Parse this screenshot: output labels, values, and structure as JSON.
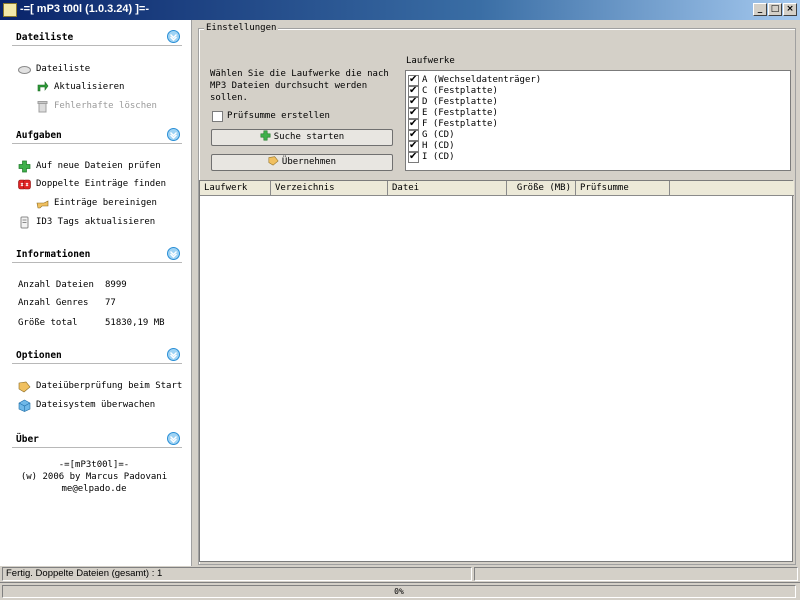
{
  "window": {
    "title": "-=[ mP3 t00l (1.0.3.24) ]=-",
    "minimize": "_",
    "maximize": "□",
    "close": "×"
  },
  "sidebar": {
    "dateiliste": {
      "title": "Dateiliste",
      "items": [
        {
          "label": "Dateiliste",
          "icon": "disk-icon"
        },
        {
          "label": "Aktualisieren",
          "icon": "refresh-icon"
        },
        {
          "label": "Fehlerhafte löschen",
          "icon": "trash-icon",
          "disabled": true
        }
      ]
    },
    "aufgaben": {
      "title": "Aufgaben",
      "items": [
        {
          "label": "Auf neue Dateien prüfen",
          "icon": "plus-icon"
        },
        {
          "label": "Doppelte Einträge finden",
          "icon": "duplicate-icon"
        },
        {
          "label": "Einträge bereinigen",
          "icon": "hand-icon"
        },
        {
          "label": "ID3 Tags aktualisieren",
          "icon": "tag-icon"
        }
      ]
    },
    "informationen": {
      "title": "Informationen",
      "rows": [
        {
          "label": "Anzahl Dateien",
          "value": "8999"
        },
        {
          "label": "Anzahl Genres",
          "value": "77"
        },
        {
          "label": "Größe total",
          "value": "51830,19 MB"
        }
      ]
    },
    "optionen": {
      "title": "Optionen",
      "items": [
        {
          "label": "Dateiüberprüfung beim Start",
          "icon": "check-file-icon"
        },
        {
          "label": "Dateisystem überwachen",
          "icon": "cube-icon"
        }
      ]
    },
    "ueber": {
      "title": "Über",
      "lines": [
        "-=[mP3t00l]=-",
        "(w) 2006 by Marcus Padovani",
        "me@elpado.de"
      ]
    }
  },
  "settings": {
    "group_title": "Einstellungen",
    "intro": "Wählen Sie die Laufwerke die nach MP3 Dateien durchsucht werden sollen.",
    "checksum_label": "Prüfsumme erstellen",
    "checksum_checked": false,
    "search_button": "Suche starten",
    "apply_button": "Übernehmen",
    "drives_label": "Laufwerke",
    "drives": [
      {
        "label": "A (Wechseldatenträger)",
        "checked": true
      },
      {
        "label": "C (Festplatte)",
        "checked": true
      },
      {
        "label": "D (Festplatte)",
        "checked": true
      },
      {
        "label": "E (Festplatte)",
        "checked": true
      },
      {
        "label": "F (Festplatte)",
        "checked": true
      },
      {
        "label": "G (CD)",
        "checked": true
      },
      {
        "label": "H (CD)",
        "checked": true
      },
      {
        "label": "I (CD)",
        "checked": true
      }
    ]
  },
  "table": {
    "columns": [
      "Laufwerk",
      "Verzeichnis",
      "Datei",
      "Größe (MB)",
      "Prüfsumme"
    ]
  },
  "status": {
    "text": "Fertig. Doppelte Dateien (gesamt) : 1"
  },
  "progress": {
    "value": 0,
    "label": "0%"
  },
  "colors": {
    "title_bar": "#0a246a",
    "chevron": "#2a8fd6"
  }
}
